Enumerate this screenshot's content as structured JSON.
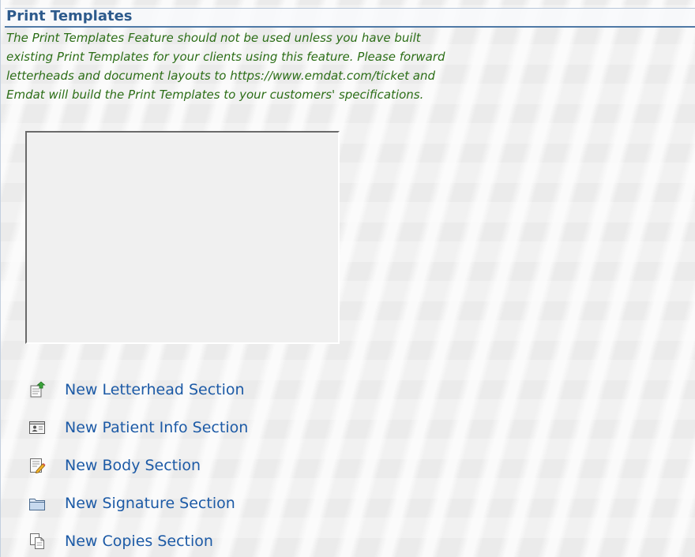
{
  "page": {
    "title": "Print Templates"
  },
  "notice": {
    "lines": [
      "The Print Templates Feature should not be used unless you have built",
      "existing Print Templates for your clients using this feature. Please forward",
      "letterheads and document layouts to https://www.emdat.com/ticket and",
      "Emdat will build the Print Templates to your customers' specifications."
    ]
  },
  "menu": {
    "items": [
      {
        "label": "New Letterhead Section",
        "icon": "letterhead-add-icon"
      },
      {
        "label": "New Patient Info Section",
        "icon": "patient-info-icon"
      },
      {
        "label": "New Body Section",
        "icon": "body-edit-icon"
      },
      {
        "label": "New Signature Section",
        "icon": "folder-icon"
      },
      {
        "label": "New Copies Section",
        "icon": "copies-icon"
      }
    ]
  },
  "colors": {
    "title": "#2d5a8c",
    "notice_text": "#2c6e17",
    "link": "#1c5aa6",
    "header_rule": "#4f79a6"
  }
}
